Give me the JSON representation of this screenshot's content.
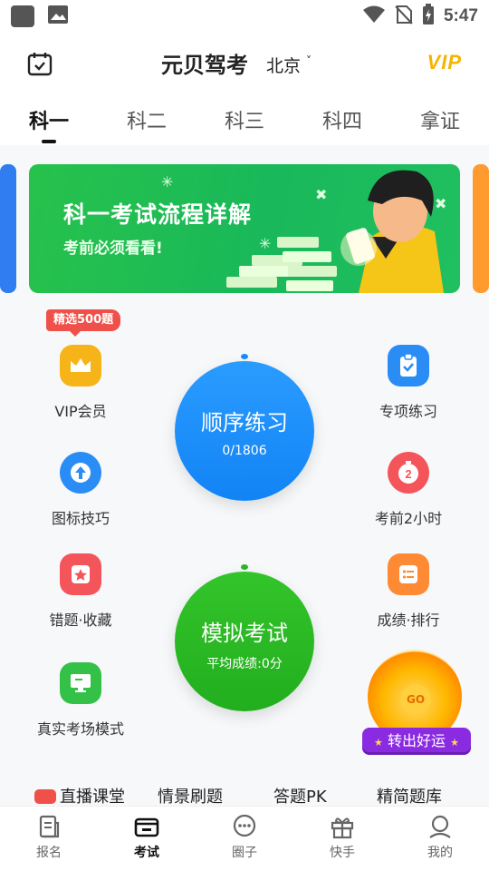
{
  "status_bar": {
    "time": "5:47"
  },
  "header": {
    "title": "元贝驾考",
    "city": "北京",
    "vip_logo": "VIP"
  },
  "tabs": [
    {
      "label": "科一",
      "active": true
    },
    {
      "label": "科二"
    },
    {
      "label": "科三"
    },
    {
      "label": "科四"
    },
    {
      "label": "拿证"
    }
  ],
  "banner": {
    "title": "科一考试流程详解",
    "subtitle": "考前必须看看!"
  },
  "badge": "精选500题",
  "tiles": {
    "vip": "VIP会员",
    "topic": "专项练习",
    "sign": "图标技巧",
    "last2h": "考前2小时",
    "mistakes": "错题·收藏",
    "ranking": "成绩·排行",
    "real_exam": "真实考场模式"
  },
  "order_practice": {
    "title": "顺序练习",
    "progress": "0/1806"
  },
  "mock_exam": {
    "title": "模拟考试",
    "avg_score": "平均成绩:0分"
  },
  "lottery": {
    "button": "转出好运",
    "go": "GO"
  },
  "quick_links": [
    "直播课堂",
    "情景刷题",
    "答题PK",
    "精简题库"
  ],
  "bottom_nav": [
    {
      "label": "报名"
    },
    {
      "label": "考试",
      "active": true
    },
    {
      "label": "圈子"
    },
    {
      "label": "快手"
    },
    {
      "label": "我的"
    }
  ],
  "colors": {
    "order_blue": "#1a8cff",
    "mock_green": "#28b923",
    "vip_gold": "#f5b400",
    "badge_red": "#f0504a"
  }
}
